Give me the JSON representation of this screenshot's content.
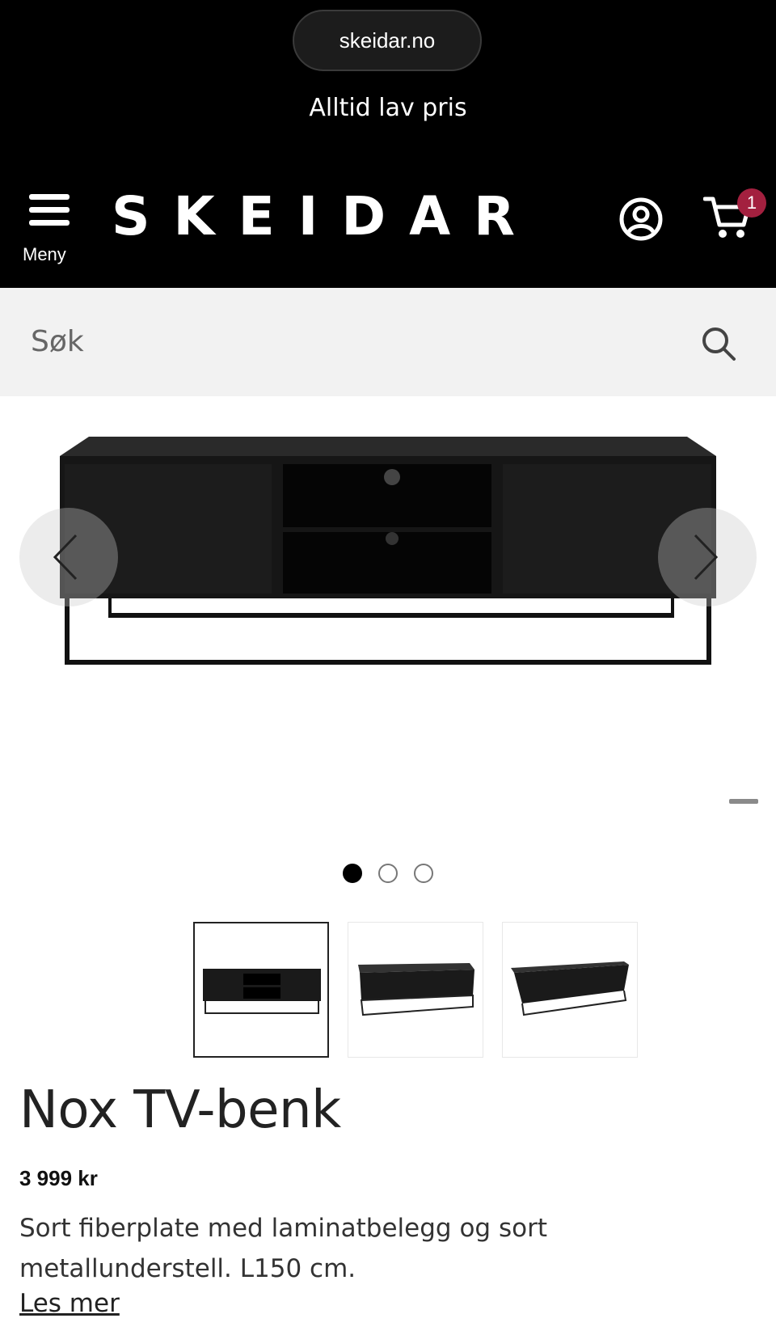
{
  "browser": {
    "url": "skeidar.no"
  },
  "banner": {
    "tagline": "Alltid lav pris"
  },
  "header": {
    "menu_label": "Meny",
    "logo_text": "SKEIDAR",
    "cart_count": "1",
    "icons": [
      "hamburger-menu-icon",
      "account-icon",
      "shopping-cart-icon"
    ]
  },
  "search": {
    "placeholder": "Søk",
    "icon": "search-icon"
  },
  "gallery": {
    "image_count": 3,
    "active_index": 0,
    "thumbnails": [
      "front-view",
      "angled-view",
      "side-angled-view"
    ]
  },
  "product": {
    "title": "Nox TV-benk",
    "price": "3 999 kr",
    "description": "Sort fiberplate med laminatbelegg og sort metallunderstell. L150 cm.",
    "read_more": "Les mer"
  },
  "colors": {
    "header_bg": "#000000",
    "badge": "#a3203f",
    "search_bg": "#f2f2f2"
  }
}
